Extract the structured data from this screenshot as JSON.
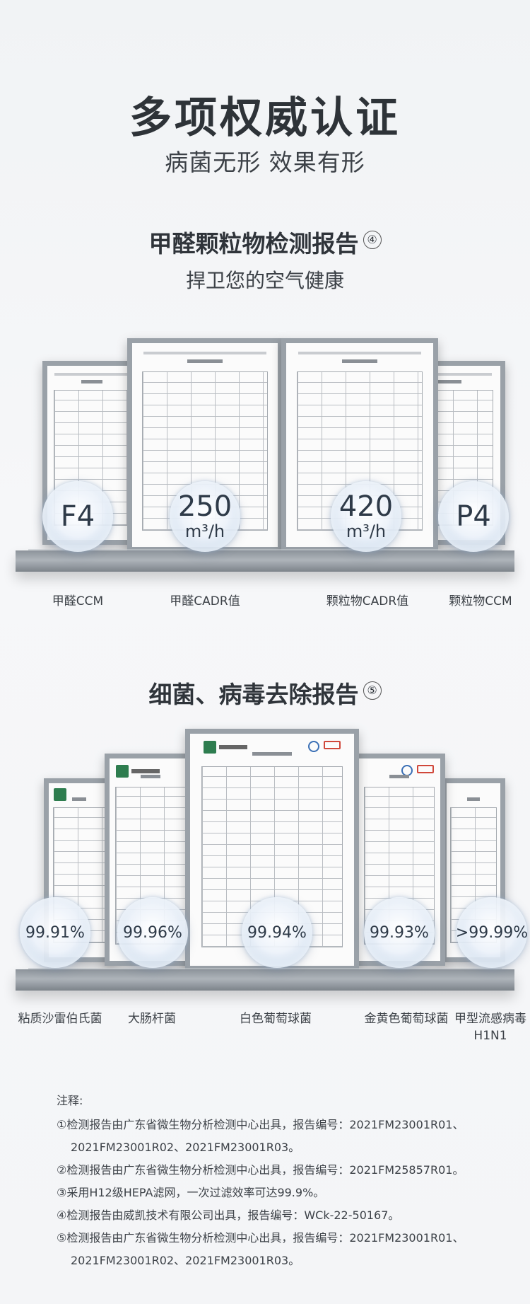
{
  "header": {
    "title": "多项权威认证",
    "subtitle": "病菌无形 效果有形"
  },
  "section1": {
    "title": "甲醛颗粒物检测报告",
    "num": "④",
    "subtitle": "捍卫您的空气健康",
    "bubbles": [
      {
        "value": "F4",
        "unit": ""
      },
      {
        "value": "250",
        "unit": "m³/h"
      },
      {
        "value": "420",
        "unit": "m³/h"
      },
      {
        "value": "P4",
        "unit": ""
      }
    ],
    "captions": [
      "甲醛CCM",
      "甲醛CADR值",
      "颗粒物CADR值",
      "颗粒物CCM"
    ]
  },
  "section2": {
    "title": "细菌、病毒去除报告",
    "num": "⑤",
    "bubbles": [
      "99.91%",
      "99.96%",
      "99.94%",
      "99.93%",
      ">99.99%"
    ],
    "captions": [
      "粘质沙雷伯氏菌",
      "大肠杆菌",
      "白色葡萄球菌",
      "金黄色葡萄球菌",
      "甲型流感病毒"
    ],
    "caption5_line2": "H1N1"
  },
  "notes": {
    "head": "注释:",
    "n1a": "①检测报告由广东省微生物分析检测中心出具，报告编号：2021FM23001R01、",
    "n1b": "2021FM23001R02、2021FM23001R03。",
    "n2": "②检测报告由广东省微生物分析检测中心出具，报告编号：2021FM25857R01。",
    "n3": "③采用H12级HEPA滤网，一次过滤效率可达99.9%。",
    "n4": "④检测报告由威凯技术有限公司出具，报告编号：WCk-22-50167。",
    "n5a": "⑤检测报告由广东省微生物分析检测中心出具，报告编号：2021FM23001R01、",
    "n5b": "2021FM23001R02、2021FM23001R03。"
  }
}
